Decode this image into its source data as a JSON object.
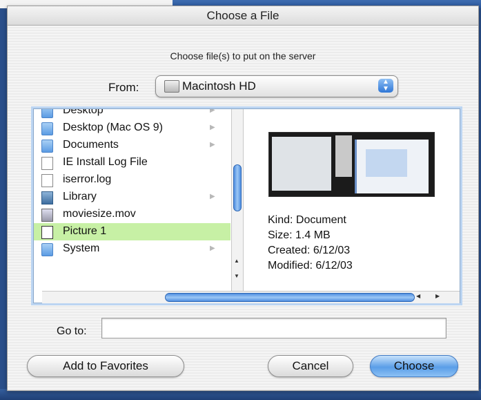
{
  "window": {
    "title": "Choose a File"
  },
  "dialog": {
    "prompt": "Choose file(s) to put on the server",
    "from_label": "From:",
    "from_value": "Macintosh HD",
    "files": [
      {
        "name": "Desktop",
        "icon": "folder-icon",
        "folder": true,
        "selected": false
      },
      {
        "name": "Desktop (Mac OS 9)",
        "icon": "folder-icon",
        "folder": true,
        "selected": false
      },
      {
        "name": "Documents",
        "icon": "folder-icon",
        "folder": true,
        "selected": false
      },
      {
        "name": "IE Install Log File",
        "icon": "document-icon",
        "folder": false,
        "selected": false
      },
      {
        "name": "iserror.log",
        "icon": "document-icon",
        "folder": false,
        "selected": false
      },
      {
        "name": "Library",
        "icon": "library-folder-icon",
        "folder": true,
        "selected": false
      },
      {
        "name": "moviesize.mov",
        "icon": "movie-file-icon",
        "folder": false,
        "selected": false
      },
      {
        "name": "Picture 1",
        "icon": "picture-file-icon",
        "folder": false,
        "selected": true
      },
      {
        "name": "System",
        "icon": "folder-icon",
        "folder": true,
        "selected": false
      }
    ],
    "preview": {
      "kind": "Kind: Document",
      "size": "Size: 1.4 MB",
      "created": "Created: 6/12/03",
      "modified": "Modified: 6/12/03"
    },
    "goto_label": "Go to:",
    "goto_value": "",
    "buttons": {
      "favorites": "Add to Favorites",
      "cancel": "Cancel",
      "choose": "Choose"
    }
  }
}
